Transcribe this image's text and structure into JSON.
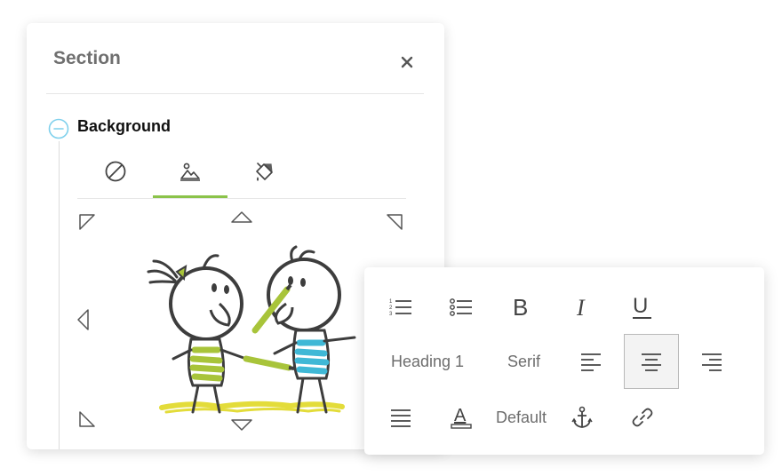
{
  "section": {
    "title": "Section",
    "close_icon": "close-icon",
    "background_label": "Background",
    "collapse_icon": "minus-circle-icon",
    "tabs": [
      {
        "name": "none",
        "icon": "no-background-icon",
        "active": false
      },
      {
        "name": "image",
        "icon": "image-icon",
        "active": true
      },
      {
        "name": "color",
        "icon": "paint-bucket-icon",
        "active": false
      }
    ],
    "colors": {
      "accent": "#8bc34a",
      "collapse": "#7fd0ec",
      "arrows": "#555555"
    },
    "illustration": {
      "icon": "kids-drawing-illustration",
      "colors": [
        "#a8c43a",
        "#3fb8d6",
        "#e3dc3a"
      ]
    }
  },
  "toolbar": {
    "row1": [
      "ordered-list-icon",
      "unordered-list-icon",
      "bold-icon",
      "italic-icon",
      "underline-icon"
    ],
    "heading_label": "Heading 1",
    "font_label": "Serif",
    "align": [
      "align-left-icon",
      "align-center-icon",
      "align-right-icon"
    ],
    "selected_align": "center",
    "row3": [
      "justify-icon",
      "text-color-icon"
    ],
    "size_label": "Default",
    "anchor_icon": "anchor-icon",
    "link_icon": "link-icon",
    "glyphs": {
      "bold": "B",
      "italic": "I",
      "underline": "U",
      "text_color": "A"
    }
  }
}
